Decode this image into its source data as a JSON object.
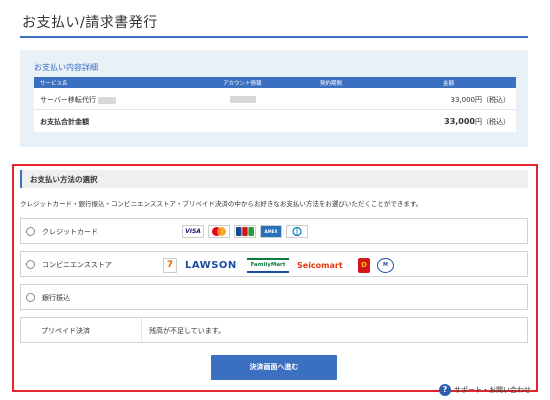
{
  "page": {
    "title": "お支払い/請求書発行"
  },
  "details": {
    "heading": "お支払い内容詳細",
    "columns": {
      "service": "サービス名",
      "account": "アカウント情報",
      "contract": "契約期間",
      "amount": "金額"
    },
    "row": {
      "service": "サーバー移転代行",
      "amount": "33,000円（税込）"
    },
    "total": {
      "label": "お支払合計金額",
      "amount_number": "33,000",
      "amount_suffix": "円（税込）"
    }
  },
  "method": {
    "heading": "お支払い方法の選択",
    "description": "クレジットカード・銀行振込・コンビニエンスストア・プリペイド決済の中からお好きなお支払い方法をお選びいただくことができます。",
    "options": [
      {
        "label": "クレジットカード",
        "logos": [
          "VISA",
          "Mastercard",
          "JCB",
          "AMEX",
          "Diners Club"
        ]
      },
      {
        "label": "コンビニエンスストア",
        "logos": [
          "7",
          "LAWSON",
          "FamilyMart",
          "Seicomart",
          "Daily Yamazaki",
          "Mini Stop"
        ]
      },
      {
        "label": "銀行振込"
      },
      {
        "label": "プリペイド決済",
        "message": "残高が不足しています。"
      }
    ]
  },
  "submit": {
    "label": "決済画面へ進む"
  },
  "support": {
    "label": "サポート・お問い合わせ"
  },
  "colors": {
    "accent": "#3b6fc0",
    "highlight_frame": "#e3262d"
  }
}
